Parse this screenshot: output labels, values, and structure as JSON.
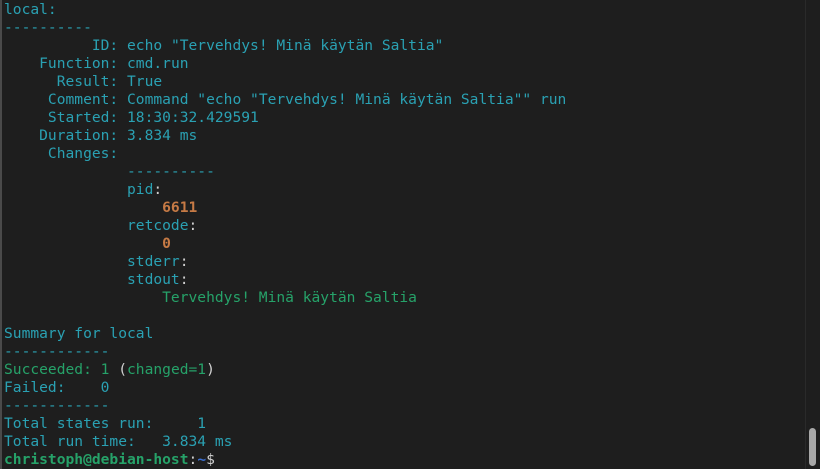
{
  "terminal": {
    "lines": {
      "l01": "local:",
      "l02": "----------",
      "l03_key": "          ID:",
      "l03_val": " echo \"Tervehdys! Minä käytän Saltia\"",
      "l04_key": "    Function:",
      "l04_val": " cmd.run",
      "l05_key": "      Result:",
      "l05_val": " True",
      "l06_key": "     Comment:",
      "l06_val": " Command \"echo \"Tervehdys! Minä käytän Saltia\"\" run",
      "l07_key": "     Started:",
      "l07_val": " 18:30:32.429591",
      "l08_key": "    Duration:",
      "l08_val": " 3.834 ms",
      "l09_key": "     Changes:",
      "l10": "              ----------",
      "l11_key": "              pid",
      "l11_colon": ":",
      "l12_val": "                  6611",
      "l13_key": "              retcode",
      "l13_colon": ":",
      "l14_val": "                  0",
      "l15_key": "              stderr",
      "l15_colon": ":",
      "l16_key": "              stdout",
      "l16_colon": ":",
      "l17_val": "                  Tervehdys! Minä käytän Saltia",
      "l19": "Summary for local",
      "l20": "------------",
      "l21_a": "Succeeded: 1",
      "l21_b": " (",
      "l21_c": "changed=1",
      "l21_d": ")",
      "l22": "Failed:    0",
      "l23": "------------",
      "l24": "Total states run:     1",
      "l25": "Total run time:   3.834 ms"
    },
    "prompt": {
      "user_host": "christoph@debian-host",
      "separator": ":",
      "path": "~",
      "symbol": "$"
    }
  },
  "colors": {
    "background": "#1e1e1e",
    "cyan": "#2aa1b3",
    "green": "#26a269",
    "orange": "#c67a45",
    "blue": "#3b6fd1"
  }
}
